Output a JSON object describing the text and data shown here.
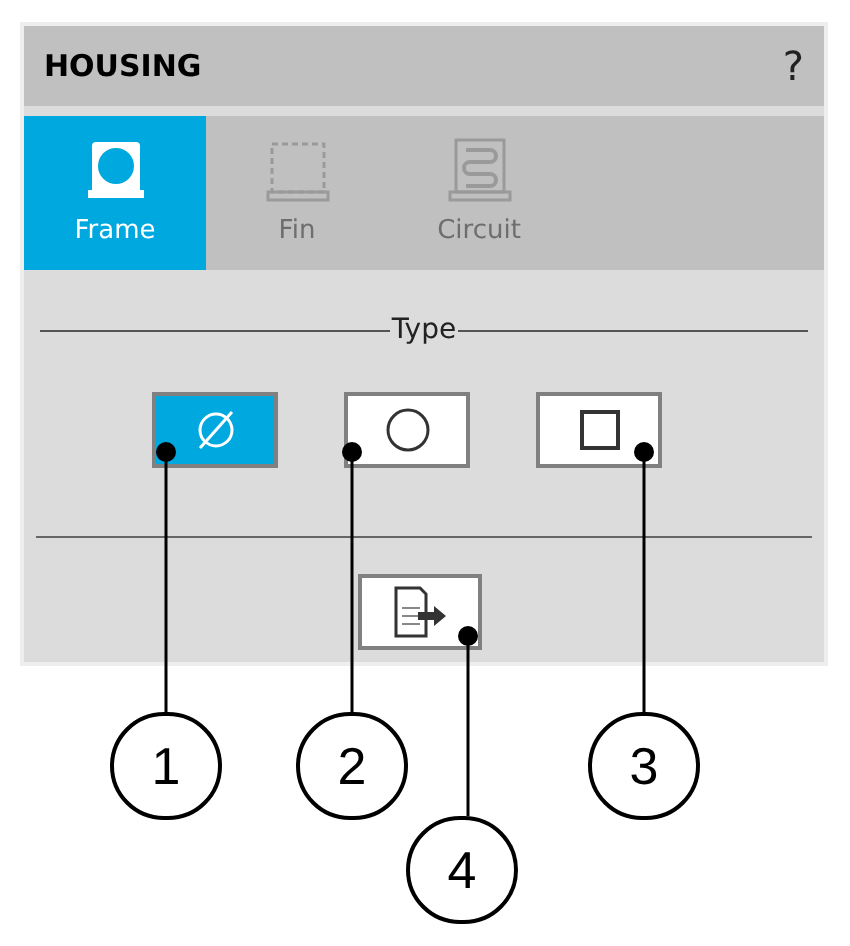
{
  "header": {
    "title": "HOUSING",
    "help": "?"
  },
  "tabs": [
    {
      "kind": "frame",
      "label": "Frame",
      "selected": true
    },
    {
      "kind": "fin",
      "label": "Fin",
      "selected": false
    },
    {
      "kind": "circuit",
      "label": "Circuit",
      "selected": false
    }
  ],
  "type_group": {
    "label": "Type",
    "options": [
      {
        "kind": "diameter",
        "selected": true
      },
      {
        "kind": "circle",
        "selected": false
      },
      {
        "kind": "square",
        "selected": false
      }
    ]
  },
  "callouts": [
    "1",
    "2",
    "3",
    "4"
  ]
}
